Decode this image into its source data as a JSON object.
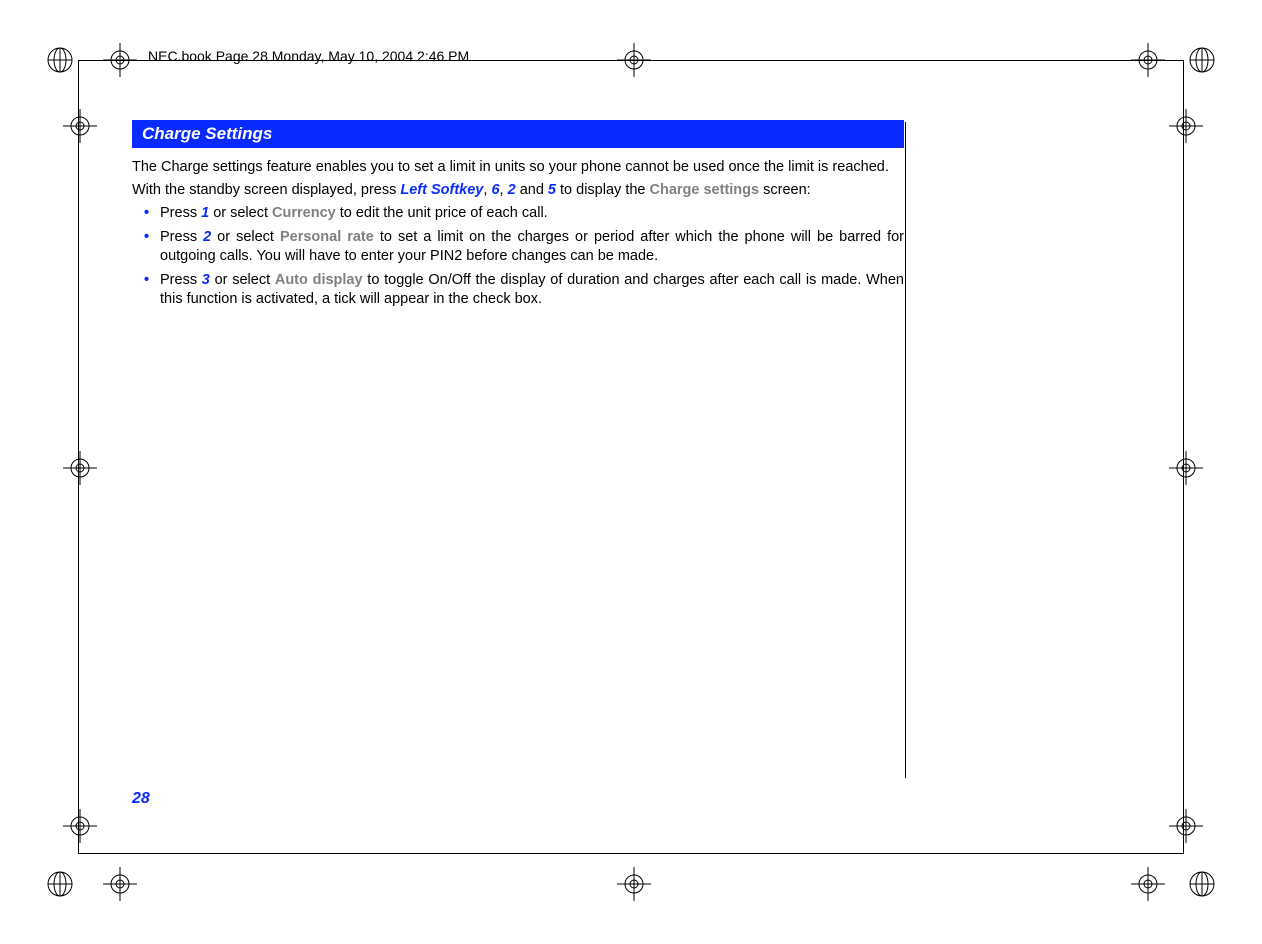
{
  "header": "NEC.book  Page 28  Monday, May 10, 2004  2:46 PM",
  "section_title": "Charge Settings",
  "para1_a": "The Charge settings feature enables you to set a limit in units so your phone cannot be used once the limit is reached.",
  "para2_a": "With the standby screen displayed, press ",
  "para2_softkey": "Left Softkey",
  "para2_b": ", ",
  "para2_k6": "6",
  "para2_c": ", ",
  "para2_k2": "2",
  "para2_d": " and ",
  "para2_k5": "5",
  "para2_e": " to display the ",
  "para2_label": "Charge settings",
  "para2_f": " screen:",
  "b1_a": "Press ",
  "b1_k": "1",
  "b1_b": " or select ",
  "b1_label": "Currency",
  "b1_c": " to edit the unit price of each call.",
  "b2_a": "Press ",
  "b2_k": "2",
  "b2_b": " or select ",
  "b2_label": "Personal rate",
  "b2_c": " to set a limit on the charges or period after which the phone will be barred for outgoing calls. You will have to enter your PIN2 before changes can be made.",
  "b3_a": "Press ",
  "b3_k": "3",
  "b3_b": " or select ",
  "b3_label": "Auto display",
  "b3_c": " to toggle On/Off the display of duration and charges after each call is made. When this function is activated, a tick will appear in the check box.",
  "page_number": "28"
}
